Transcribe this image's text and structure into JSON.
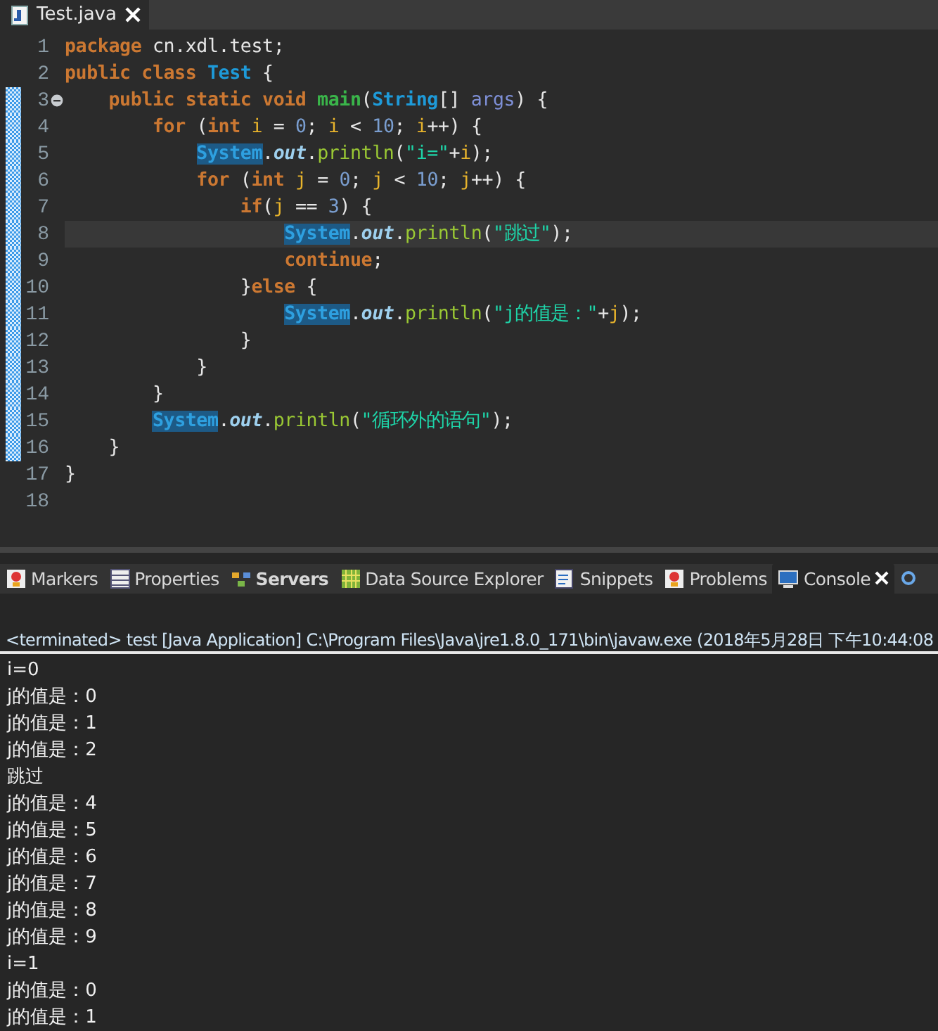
{
  "editor_tab": {
    "title": "Test.java",
    "selected": true
  },
  "code": [
    {
      "n": "1",
      "changed": false,
      "tokens": [
        {
          "kind": "kw",
          "t": "package"
        },
        {
          "kind": "plain",
          "t": " cn.xdl.test;"
        }
      ]
    },
    {
      "n": "2",
      "changed": false,
      "tokens": [
        {
          "kind": "kw",
          "t": "public class "
        },
        {
          "kind": "type",
          "t": "Test"
        },
        {
          "kind": "plain",
          "t": " {"
        }
      ]
    },
    {
      "n": "3",
      "changed": true,
      "fold": true,
      "tokens": [
        {
          "kind": "kw",
          "t": "    public static void "
        },
        {
          "kind": "method",
          "t": "main"
        },
        {
          "kind": "plain",
          "t": "("
        },
        {
          "kind": "type",
          "t": "String"
        },
        {
          "kind": "plain",
          "t": "[] "
        },
        {
          "kind": "param",
          "t": "args"
        },
        {
          "kind": "plain",
          "t": ") {"
        }
      ]
    },
    {
      "n": "4",
      "changed": true,
      "tokens": [
        {
          "kind": "kw",
          "t": "        for"
        },
        {
          "kind": "plain",
          "t": " ("
        },
        {
          "kind": "kw",
          "t": "int "
        },
        {
          "kind": "var",
          "t": "i"
        },
        {
          "kind": "plain",
          "t": " = "
        },
        {
          "kind": "num",
          "t": "0"
        },
        {
          "kind": "plain",
          "t": "; "
        },
        {
          "kind": "var",
          "t": "i"
        },
        {
          "kind": "plain",
          "t": " < "
        },
        {
          "kind": "num",
          "t": "10"
        },
        {
          "kind": "plain",
          "t": "; "
        },
        {
          "kind": "var",
          "t": "i"
        },
        {
          "kind": "plain",
          "t": "++) {"
        }
      ]
    },
    {
      "n": "5",
      "changed": true,
      "tokens": [
        {
          "kind": "sys",
          "t": "            System"
        },
        {
          "kind": "plain",
          "t": "."
        },
        {
          "kind": "field",
          "t": "out"
        },
        {
          "kind": "plain",
          "t": "."
        },
        {
          "kind": "call",
          "t": "println"
        },
        {
          "kind": "plain",
          "t": "("
        },
        {
          "kind": "str",
          "t": "\"i=\""
        },
        {
          "kind": "plain",
          "t": "+"
        },
        {
          "kind": "var",
          "t": "i"
        },
        {
          "kind": "plain",
          "t": ");"
        }
      ]
    },
    {
      "n": "6",
      "changed": true,
      "tokens": [
        {
          "kind": "kw",
          "t": "            for"
        },
        {
          "kind": "plain",
          "t": " ("
        },
        {
          "kind": "kw",
          "t": "int "
        },
        {
          "kind": "var",
          "t": "j"
        },
        {
          "kind": "plain",
          "t": " = "
        },
        {
          "kind": "num",
          "t": "0"
        },
        {
          "kind": "plain",
          "t": "; "
        },
        {
          "kind": "var",
          "t": "j"
        },
        {
          "kind": "plain",
          "t": " < "
        },
        {
          "kind": "num",
          "t": "10"
        },
        {
          "kind": "plain",
          "t": "; "
        },
        {
          "kind": "var",
          "t": "j"
        },
        {
          "kind": "plain",
          "t": "++) {"
        }
      ]
    },
    {
      "n": "7",
      "changed": true,
      "tokens": [
        {
          "kind": "kw",
          "t": "                if"
        },
        {
          "kind": "plain",
          "t": "("
        },
        {
          "kind": "var",
          "t": "j"
        },
        {
          "kind": "plain",
          "t": " == "
        },
        {
          "kind": "num",
          "t": "3"
        },
        {
          "kind": "plain",
          "t": ") {"
        }
      ]
    },
    {
      "n": "8",
      "changed": true,
      "current": true,
      "tokens": [
        {
          "kind": "sys",
          "t": "                    System"
        },
        {
          "kind": "plain",
          "t": "."
        },
        {
          "kind": "field",
          "t": "out"
        },
        {
          "kind": "plain",
          "t": "."
        },
        {
          "kind": "call",
          "t": "println"
        },
        {
          "kind": "plain",
          "t": "("
        },
        {
          "kind": "str",
          "t": "\"跳过\""
        },
        {
          "kind": "plain",
          "t": ");"
        }
      ]
    },
    {
      "n": "9",
      "changed": true,
      "tokens": [
        {
          "kind": "kw",
          "t": "                    continue"
        },
        {
          "kind": "plain",
          "t": ";"
        }
      ]
    },
    {
      "n": "10",
      "changed": true,
      "tokens": [
        {
          "kind": "plain",
          "t": "                }"
        },
        {
          "kind": "kw",
          "t": "else"
        },
        {
          "kind": "plain",
          "t": " {"
        }
      ]
    },
    {
      "n": "11",
      "changed": true,
      "tokens": [
        {
          "kind": "sys",
          "t": "                    System"
        },
        {
          "kind": "plain",
          "t": "."
        },
        {
          "kind": "field",
          "t": "out"
        },
        {
          "kind": "plain",
          "t": "."
        },
        {
          "kind": "call",
          "t": "println"
        },
        {
          "kind": "plain",
          "t": "("
        },
        {
          "kind": "str",
          "t": "\"j的值是：\""
        },
        {
          "kind": "plain",
          "t": "+"
        },
        {
          "kind": "var",
          "t": "j"
        },
        {
          "kind": "plain",
          "t": ");"
        }
      ]
    },
    {
      "n": "12",
      "changed": true,
      "tokens": [
        {
          "kind": "plain",
          "t": "                }"
        }
      ]
    },
    {
      "n": "13",
      "changed": true,
      "tokens": [
        {
          "kind": "plain",
          "t": "            }"
        }
      ]
    },
    {
      "n": "14",
      "changed": true,
      "tokens": [
        {
          "kind": "plain",
          "t": "        }"
        }
      ]
    },
    {
      "n": "15",
      "changed": true,
      "tokens": [
        {
          "kind": "sys",
          "t": "        System"
        },
        {
          "kind": "plain",
          "t": "."
        },
        {
          "kind": "field",
          "t": "out"
        },
        {
          "kind": "plain",
          "t": "."
        },
        {
          "kind": "call",
          "t": "println"
        },
        {
          "kind": "plain",
          "t": "("
        },
        {
          "kind": "str",
          "t": "\"循环外的语句\""
        },
        {
          "kind": "plain",
          "t": ");"
        }
      ]
    },
    {
      "n": "16",
      "changed": true,
      "tokens": [
        {
          "kind": "plain",
          "t": "    }"
        }
      ]
    },
    {
      "n": "17",
      "changed": false,
      "tokens": [
        {
          "kind": "plain",
          "t": "}"
        }
      ]
    },
    {
      "n": "18",
      "changed": false
    }
  ],
  "view_tabs": [
    {
      "label": "Markers",
      "selected": false,
      "bold": false
    },
    {
      "label": "Properties",
      "selected": false,
      "bold": false
    },
    {
      "label": "Servers",
      "selected": false,
      "bold": true
    },
    {
      "label": "Data Source Explorer",
      "selected": false,
      "bold": false
    },
    {
      "label": "Snippets",
      "selected": false,
      "bold": false
    },
    {
      "label": "Problems",
      "selected": false,
      "bold": false
    },
    {
      "label": "Console",
      "selected": true,
      "bold": false
    }
  ],
  "console": {
    "header": "<terminated> test [Java Application] C:\\Program Files\\Java\\jre1.8.0_171\\bin\\javaw.exe (2018年5月28日 下午10:44:08",
    "lines": [
      "i=0",
      "j的值是：0",
      "j的值是：1",
      "j的值是：2",
      "跳过",
      "j的值是：4",
      "j的值是：5",
      "j的值是：6",
      "j的值是：7",
      "j的值是：8",
      "j的值是：9",
      "i=1",
      "j的值是：0",
      "j的值是：1"
    ]
  }
}
